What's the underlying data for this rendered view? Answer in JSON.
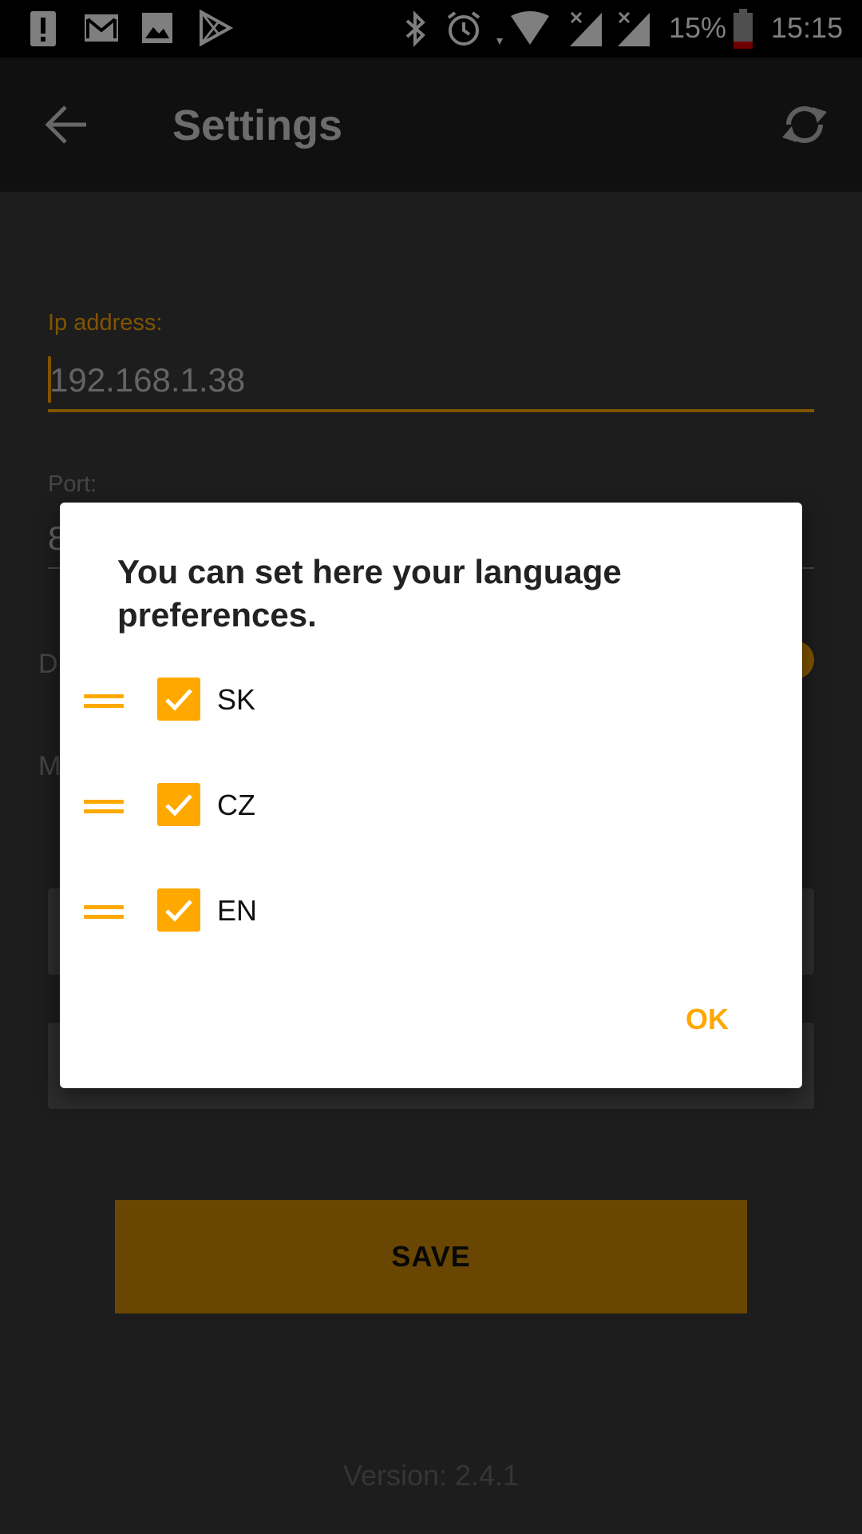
{
  "status_bar": {
    "battery_percent": "15%",
    "time": "15:15"
  },
  "app_bar": {
    "title": "Settings"
  },
  "settings": {
    "ip_label": "Ip address:",
    "ip_value": "192.168.1.38",
    "port_label": "Port:",
    "port_value_visible": "8",
    "row3_visible": "D",
    "row4_visible": "M"
  },
  "save_label": "SAVE",
  "version": "Version: 2.4.1",
  "dialog": {
    "title": "You can set here your language preferences.",
    "languages": [
      {
        "label": "SK",
        "checked": true
      },
      {
        "label": "CZ",
        "checked": true
      },
      {
        "label": "EN",
        "checked": true
      }
    ],
    "ok_label": "OK"
  },
  "colors": {
    "accent": "#ffa800",
    "appbar": "#212121",
    "background": "#3a3a3a"
  }
}
